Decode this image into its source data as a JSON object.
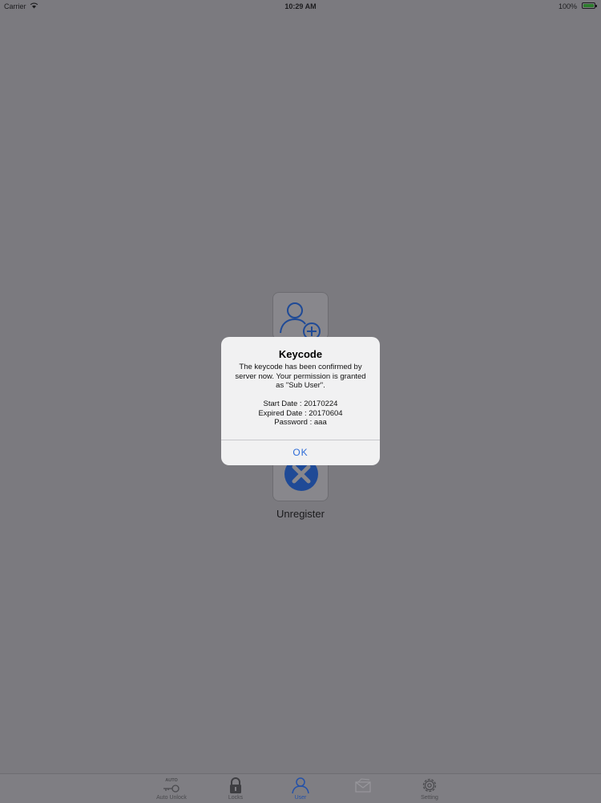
{
  "status_bar": {
    "carrier": "Carrier",
    "time": "10:29 AM",
    "battery": "100%"
  },
  "background": {
    "unregister_label": "Unregister"
  },
  "alert": {
    "title": "Keycode",
    "message": "The keycode has been confirmed by server now. Your permission is granted as \"Sub User\".",
    "start_date": "Start Date : 20170224",
    "expired_date": "Expired Date : 20170604",
    "password": "Password : aaa",
    "ok_label": "OK"
  },
  "tab_bar": {
    "items": [
      {
        "label": "Auto Unlock",
        "icon": "auto-key-icon",
        "badge": "AUTO"
      },
      {
        "label": "Locks",
        "icon": "lock-icon"
      },
      {
        "label": "User",
        "icon": "user-icon",
        "active": true
      },
      {
        "label": "",
        "icon": "mail-icon"
      },
      {
        "label": "Setting",
        "icon": "gear-icon"
      }
    ]
  },
  "colors": {
    "overlay": "#7b7a7f",
    "accent": "#2f6dd8",
    "brand_blue": "#1f4a96"
  }
}
